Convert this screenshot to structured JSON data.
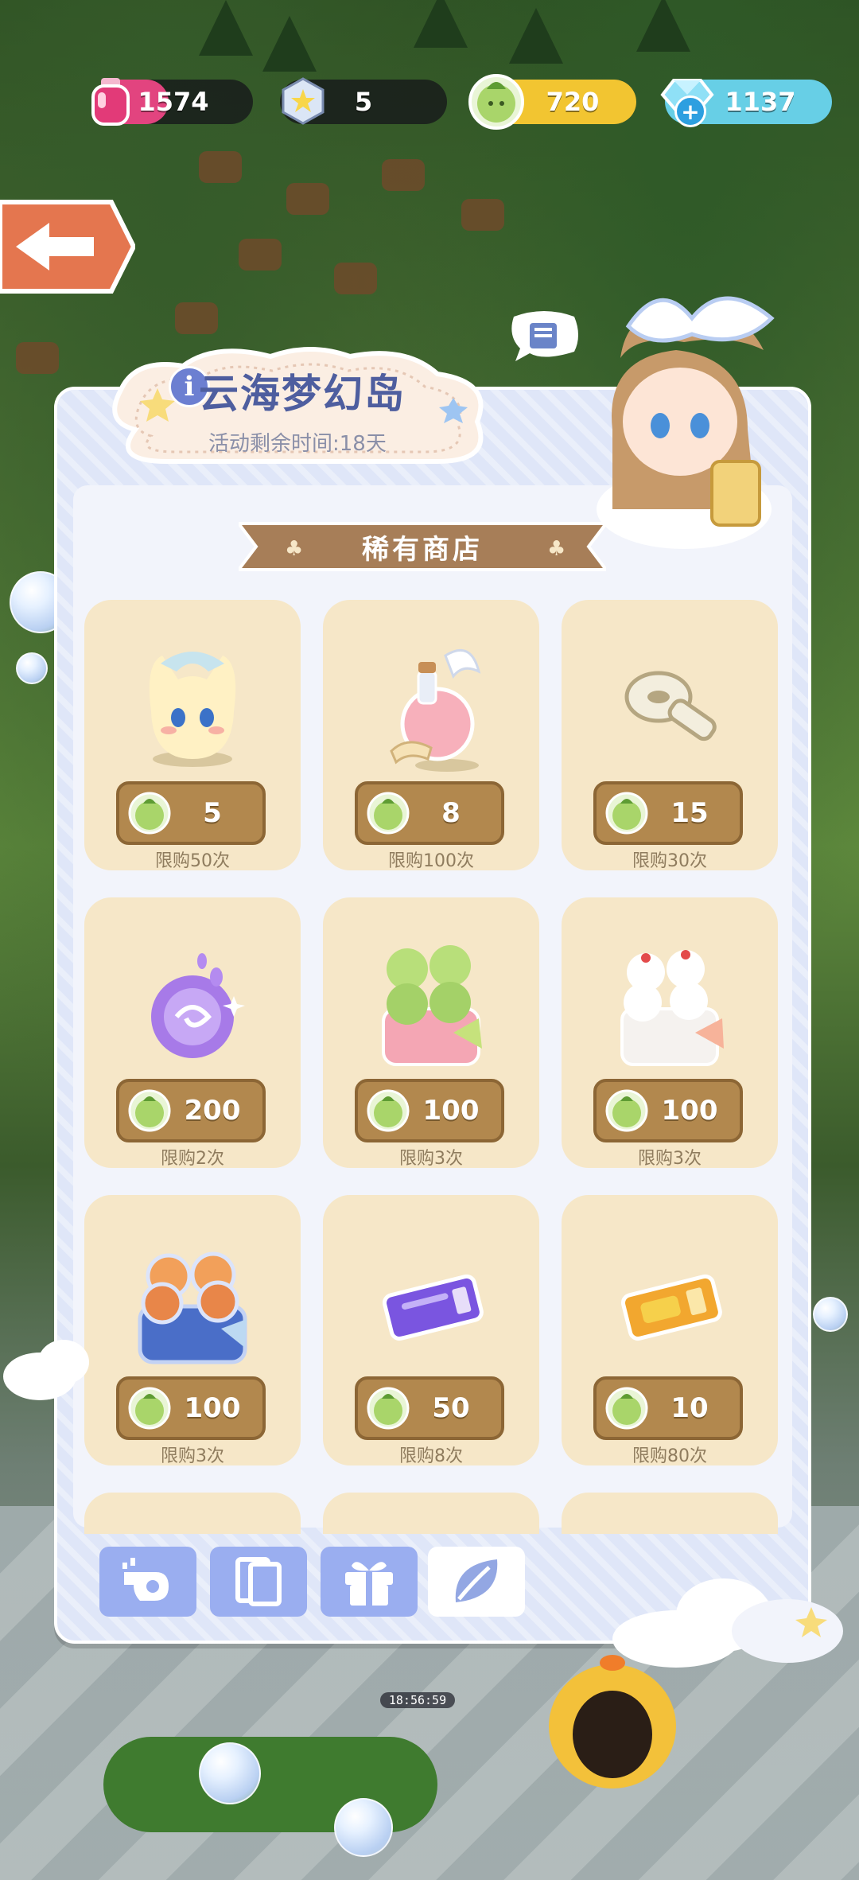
{
  "resources": [
    {
      "name": "potion",
      "icon": "pink-potion-icon",
      "value": "1574",
      "fill": "#e2447f",
      "fill_pct": 0.47
    },
    {
      "name": "star-token",
      "icon": "star-badge-icon",
      "value": "5",
      "fill": "#1b1b22",
      "fill_pct": 0
    },
    {
      "name": "sprout-coin",
      "icon": "green-sprout-coin-icon",
      "value": "720",
      "fill": "#f2c531",
      "fill_pct": 1
    },
    {
      "name": "diamond",
      "icon": "blue-diamond-icon",
      "value": "1137",
      "fill": "#67cfe6",
      "fill_pct": 1
    }
  ],
  "event": {
    "title": "云海梦幻岛",
    "timer": "活动剩余时间:18天"
  },
  "shop": {
    "title": "稀有商店",
    "items": [
      {
        "name": "cat-pet",
        "price": "5",
        "limit": "限购50次"
      },
      {
        "name": "angel-potion",
        "price": "8",
        "limit": "限购100次"
      },
      {
        "name": "wind-up-key",
        "price": "15",
        "limit": "限购30次"
      },
      {
        "name": "purple-orb",
        "price": "200",
        "limit": "限购2次"
      },
      {
        "name": "plant-basket",
        "price": "100",
        "limit": "限购3次"
      },
      {
        "name": "cream-cake",
        "price": "100",
        "limit": "限购3次"
      },
      {
        "name": "flower-basket",
        "price": "100",
        "limit": "限购3次"
      },
      {
        "name": "purple-ticket",
        "price": "50",
        "limit": "限购8次"
      },
      {
        "name": "gold-ticket",
        "price": "10",
        "limit": "限购80次"
      }
    ]
  },
  "tabs": [
    {
      "name": "tab-whistle",
      "icon": "whistle-icon",
      "active": false
    },
    {
      "name": "tab-cards",
      "icon": "cards-icon",
      "active": false
    },
    {
      "name": "tab-gift",
      "icon": "gift-icon",
      "active": false
    },
    {
      "name": "tab-leaf",
      "icon": "leaf-icon",
      "active": true
    }
  ],
  "world_clock": "18:56:59",
  "colors": {
    "accent": "#9aaef0",
    "card": "#f6e7c8",
    "price": "#b2884e",
    "title": "#4e5e9f"
  }
}
